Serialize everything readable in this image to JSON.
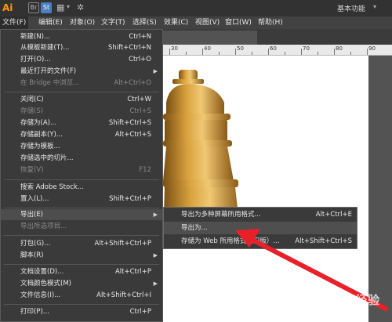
{
  "titlebar": {
    "app_logo": "Ai",
    "bridge_label": "Br",
    "stock_label": "St",
    "workspace_label": "基本功能"
  },
  "menubar": {
    "items": [
      "文件(F)",
      "编辑(E)",
      "对象(O)",
      "文字(T)",
      "选择(S)",
      "效果(C)",
      "视图(V)",
      "窗口(W)",
      "帮助(H)"
    ]
  },
  "file_menu": {
    "items": [
      {
        "label": "新建(N)...",
        "shortcut": "Ctrl+N"
      },
      {
        "label": "从模板新建(T)...",
        "shortcut": "Shift+Ctrl+N"
      },
      {
        "label": "打开(O)...",
        "shortcut": "Ctrl+O"
      },
      {
        "label": "最近打开的文件(F)",
        "shortcut": ""
      },
      {
        "label": "在 Bridge 中浏览...",
        "shortcut": "Alt+Ctrl+O"
      },
      {
        "label": "关闭(C)",
        "shortcut": "Ctrl+W"
      },
      {
        "label": "存储(S)",
        "shortcut": "Ctrl+S"
      },
      {
        "label": "存储为(A)...",
        "shortcut": "Shift+Ctrl+S"
      },
      {
        "label": "存储副本(Y)...",
        "shortcut": "Alt+Ctrl+S"
      },
      {
        "label": "存储为模板...",
        "shortcut": ""
      },
      {
        "label": "存储选中的切片...",
        "shortcut": ""
      },
      {
        "label": "恢复(V)",
        "shortcut": "F12"
      },
      {
        "label": "搜索 Adobe Stock...",
        "shortcut": ""
      },
      {
        "label": "置入(L)...",
        "shortcut": "Shift+Ctrl+P"
      },
      {
        "label": "导出(E)",
        "shortcut": ""
      },
      {
        "label": "导出所选项目...",
        "shortcut": ""
      },
      {
        "label": "打包(G)...",
        "shortcut": "Alt+Shift+Ctrl+P"
      },
      {
        "label": "脚本(R)",
        "shortcut": ""
      },
      {
        "label": "文档设置(D)...",
        "shortcut": "Alt+Ctrl+P"
      },
      {
        "label": "文档颜色模式(M)",
        "shortcut": ""
      },
      {
        "label": "文件信息(I)...",
        "shortcut": "Alt+Shift+Ctrl+I"
      },
      {
        "label": "打印(P)...",
        "shortcut": "Ctrl+P"
      }
    ]
  },
  "export_submenu": {
    "items": [
      {
        "label": "导出为多种屏幕所用格式...",
        "shortcut": "Alt+Ctrl+E"
      },
      {
        "label": "导出为...",
        "shortcut": ""
      },
      {
        "label": "存储为 Web 所用格式（旧版）...",
        "shortcut": "Alt+Shift+Ctrl+S"
      }
    ]
  },
  "ruler": {
    "labels": [
      "30",
      "40",
      "50",
      "60",
      "70",
      "80",
      "90"
    ]
  },
  "watermark": "Baidu经验",
  "colors": {
    "titlebar": "#323232",
    "menubar": "#424242",
    "menu_bg": "#3a3a3a",
    "highlight": "#4d4d4d",
    "piece_gold": "#c28a2c",
    "arrow_red": "#e8202a",
    "logo_orange": "#ff9a00"
  }
}
